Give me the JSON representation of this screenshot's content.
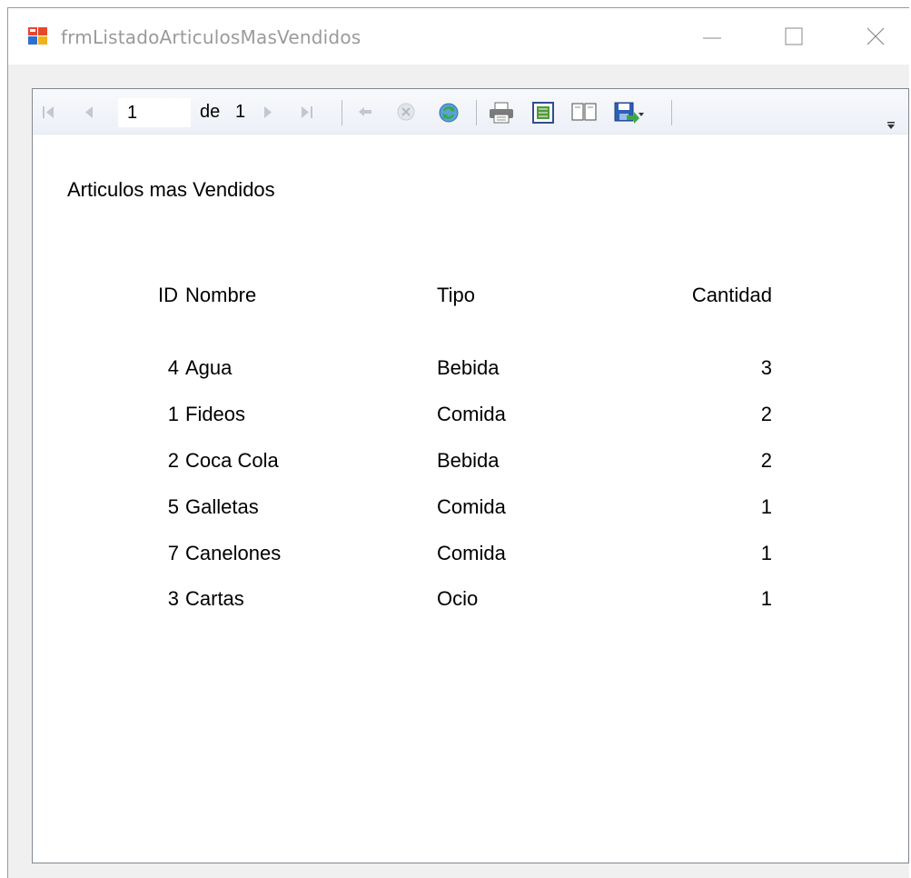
{
  "window": {
    "title": "frmListadoArticulosMasVendidos",
    "controls": [
      "minimize-icon",
      "maximize-icon",
      "close-icon"
    ]
  },
  "toolbar": {
    "current_page": "1",
    "of_label": "de",
    "page_count": "1",
    "icons": [
      "first-page-icon",
      "previous-page-icon",
      "next-page-icon",
      "last-page-icon",
      "back-icon",
      "stop-icon",
      "refresh-icon",
      "print-icon",
      "print-layout-icon",
      "page-setup-icon",
      "export-icon",
      "overflow-icon"
    ]
  },
  "report": {
    "title": "Articulos mas Vendidos",
    "headers": {
      "id": "ID",
      "nombre": "Nombre",
      "tipo": "Tipo",
      "cantidad": "Cantidad"
    },
    "rows": [
      {
        "id": "4",
        "nombre": "Agua",
        "tipo": "Bebida",
        "cantidad": "3"
      },
      {
        "id": "1",
        "nombre": "Fideos",
        "tipo": "Comida",
        "cantidad": "2"
      },
      {
        "id": "2",
        "nombre": "Coca Cola",
        "tipo": "Bebida",
        "cantidad": "2"
      },
      {
        "id": "5",
        "nombre": "Galletas",
        "tipo": "Comida",
        "cantidad": "1"
      },
      {
        "id": "7",
        "nombre": "Canelones",
        "tipo": "Comida",
        "cantidad": "1"
      },
      {
        "id": "3",
        "nombre": "Cartas",
        "tipo": "Ocio",
        "cantidad": "1"
      }
    ]
  }
}
